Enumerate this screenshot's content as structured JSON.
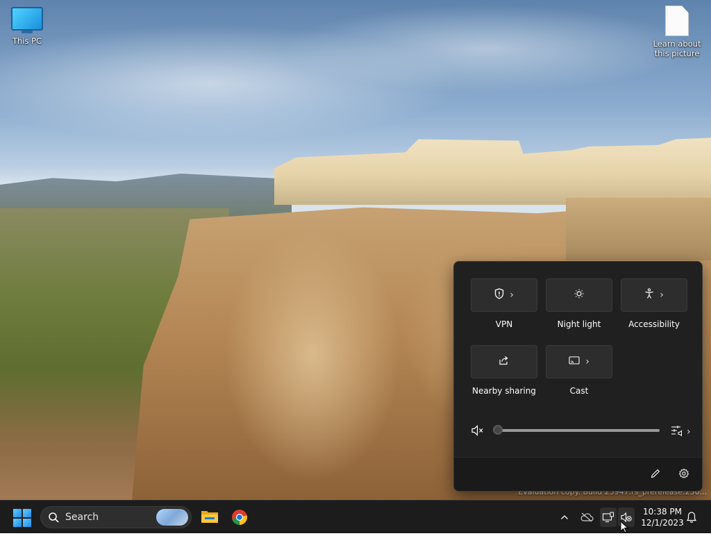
{
  "desktop": {
    "icons": [
      {
        "label": "This PC"
      },
      {
        "label": "Learn about this picture"
      }
    ],
    "watermark": "Evaluation copy. Build 25947.rs_prerelease.230..."
  },
  "quick_settings": {
    "tiles": [
      {
        "label": "VPN",
        "icon": "shield-icon",
        "has_chevron": true
      },
      {
        "label": "Night light",
        "icon": "sun-icon",
        "has_chevron": false
      },
      {
        "label": "Accessibility",
        "icon": "accessibility-icon",
        "has_chevron": true
      },
      {
        "label": "Nearby sharing",
        "icon": "share-icon",
        "has_chevron": false
      },
      {
        "label": "Cast",
        "icon": "cast-icon",
        "has_chevron": true
      }
    ],
    "volume": {
      "muted": true,
      "level": 0
    },
    "footer": {
      "edit_icon": "pencil-icon",
      "settings_icon": "gear-icon"
    }
  },
  "taskbar": {
    "search_label": "Search",
    "pinned": [
      "file-explorer-icon",
      "chrome-icon"
    ],
    "tray_icons": [
      "chevron-up-icon",
      "onedrive-icon",
      "network-icon",
      "volume-muted-icon"
    ],
    "time": "10:38 PM",
    "date": "12/1/2023",
    "notification_icon": "bell-icon"
  },
  "colors": {
    "panel_bg": "#202020",
    "tile_bg": "#2d2d2d",
    "taskbar_bg": "#1c1c1c",
    "accent": "#1f8ae6"
  }
}
